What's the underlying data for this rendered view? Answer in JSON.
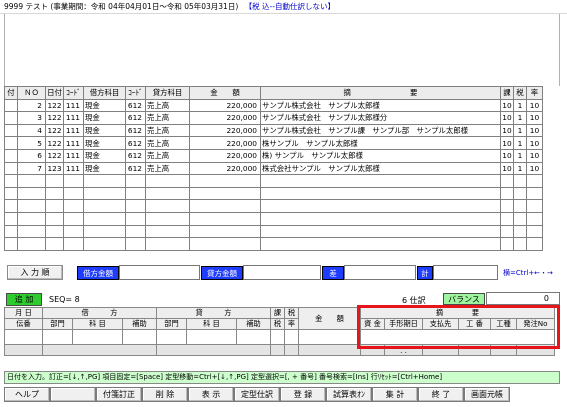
{
  "title": {
    "company": "9999 テスト",
    "period": "(事業期間：令和 04年04月01日～令和 05年03月31日)",
    "tax_mode": "【税 込--自動仕訳しない】"
  },
  "grid": {
    "headers": [
      "付",
      "ＮＯ",
      "日付",
      "ｺｰﾄﾞ",
      "借方科目",
      "ｺｰﾄﾞ",
      "貸方科目",
      "金　　額",
      "摘　　　　　　　　要",
      "課",
      "税",
      "率"
    ],
    "rows": [
      {
        "no": "2",
        "date": "122",
        "dcode": "111",
        "dname": "現金",
        "ccode": "612",
        "cname": "売上高",
        "amount": "220,000",
        "memo": "サンプル株式会社　サンプル太郎様",
        "ka": "10",
        "zei": "1",
        "rate": "10"
      },
      {
        "no": "3",
        "date": "122",
        "dcode": "111",
        "dname": "現金",
        "ccode": "612",
        "cname": "売上高",
        "amount": "220,000",
        "memo": "サンプル株式会社　サンプル太郎様分",
        "ka": "10",
        "zei": "1",
        "rate": "10"
      },
      {
        "no": "4",
        "date": "122",
        "dcode": "111",
        "dname": "現金",
        "ccode": "612",
        "cname": "売上高",
        "amount": "220,000",
        "memo": "サンプル株式会社　サンプル課　サンプル部　サンプル太郎様",
        "ka": "10",
        "zei": "1",
        "rate": "10"
      },
      {
        "no": "5",
        "date": "122",
        "dcode": "111",
        "dname": "現金",
        "ccode": "612",
        "cname": "売上高",
        "amount": "220,000",
        "memo": "株サンプル　サンプル太郎様",
        "ka": "10",
        "zei": "1",
        "rate": "10"
      },
      {
        "no": "6",
        "date": "122",
        "dcode": "111",
        "dname": "現金",
        "ccode": "612",
        "cname": "売上高",
        "amount": "220,000",
        "memo": "株) サンプル　サンプル太郎様",
        "ka": "10",
        "zei": "1",
        "rate": "10"
      },
      {
        "no": "7",
        "date": "123",
        "dcode": "111",
        "dname": "現金",
        "ccode": "612",
        "cname": "売上高",
        "amount": "220,000",
        "memo": "株式会社サンプル　サンプル太郎様",
        "ka": "10",
        "zei": "1",
        "rate": "10"
      }
    ]
  },
  "summary": {
    "input_order_button": "入 力 順",
    "debit_total_label": "借方金額",
    "credit_total_label": "貸方金額",
    "diff_label": "差",
    "total_label": "計",
    "scroll_hint": "横=Ctrl+←・→"
  },
  "entry": {
    "mode_label": "追 加",
    "seq_label": "SEQ= 8",
    "journal_count": "6 仕訳",
    "balance_label": "バランス",
    "balance_value": "0",
    "header_top": [
      "月 日",
      "借　　　方",
      "貸　　　方",
      "課",
      "税",
      "金　　額",
      "摘　　　　要"
    ],
    "header_bottom": [
      "伝番",
      "部門",
      "科 目",
      "補助",
      "部門",
      "科 目",
      "補助",
      "税",
      "率"
    ],
    "memo_sub_headers": [
      "資 金",
      "手形期日",
      "支払先",
      "工 番",
      "工種",
      "発注No"
    ],
    "memo_sub_value": ". ."
  },
  "status_text": "日付を入力。訂正=[↓,↑,PG] 項目固定=[Space] 定型移動=Ctrl+[↓,↑,PG] 定型選択=[, + 番号] 番号検索=[Ins] 行ﾘｾｯﾄ=[Ctrl+Home]",
  "fkeys": [
    "ヘルプ",
    "",
    "付箋訂正",
    "削 除",
    "表 示",
    "定型仕訳",
    "登 録",
    "試算表ｵﾝ",
    "集 計",
    "終 了",
    "画面元帳"
  ]
}
